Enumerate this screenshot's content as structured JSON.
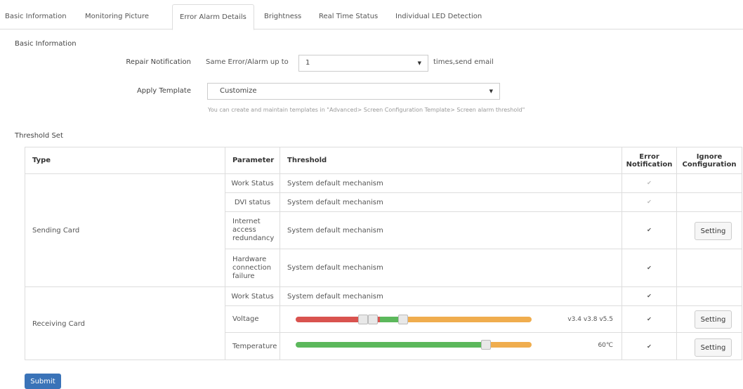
{
  "tabs": [
    {
      "label": "Basic Information"
    },
    {
      "label": "Monitoring Picture"
    },
    {
      "label": "Error Alarm Details"
    },
    {
      "label": "Brightness"
    },
    {
      "label": "Real Time Status"
    },
    {
      "label": "Individual LED Detection"
    }
  ],
  "active_tab": "Error Alarm Details",
  "basic_info": {
    "title": "Basic Information",
    "repair_label": "Repair Notification",
    "repair_prefix": "Same Error/Alarm up to",
    "repair_value": "1",
    "repair_suffix": "times,send email",
    "template_label": "Apply Template",
    "template_value": "Customize",
    "template_hint": "You can create and maintain templates in \"Advanced> Screen Configuration Template> Screen alarm threshold\""
  },
  "threshold": {
    "title": "Threshold Set",
    "headers": {
      "type": "Type",
      "parameter": "Parameter",
      "threshold": "Threshold",
      "error_notification_1": "Error",
      "error_notification_2": "Notification",
      "ignore_1": "Ignore",
      "ignore_2": "Configuration"
    },
    "groups": [
      {
        "type": "Sending Card"
      },
      {
        "type": "Receiving Card"
      }
    ],
    "rows": [
      {
        "parameter": "Work Status",
        "threshold": "System default mechanism",
        "checked": true,
        "disabled": true
      },
      {
        "parameter": "DVI status",
        "threshold": "System default mechanism",
        "checked": true,
        "disabled": true
      },
      {
        "parameter_lines": [
          "Internet",
          "access",
          "redundancy"
        ],
        "threshold": "System default mechanism",
        "checked": true,
        "disabled": false,
        "setting": "Setting"
      },
      {
        "parameter_lines": [
          "Hardware",
          "connection",
          "failure"
        ],
        "threshold": "System default mechanism",
        "checked": true,
        "disabled": false
      },
      {
        "parameter": "Work Status",
        "threshold": "System default mechanism",
        "checked": true,
        "disabled": false
      },
      {
        "parameter": "Voltage",
        "slider_value": "v3.4 v3.8 v5.5",
        "checked": true,
        "disabled": false,
        "setting": "Setting"
      },
      {
        "parameter": "Temperature",
        "slider_value": "60℃",
        "checked": true,
        "disabled": false,
        "setting": "Setting"
      }
    ]
  },
  "submit_label": "Submit",
  "colors": {
    "red": "#d9534f",
    "green": "#5cb85c",
    "orange": "#f0ad4e",
    "primary": "#3a73b8"
  }
}
